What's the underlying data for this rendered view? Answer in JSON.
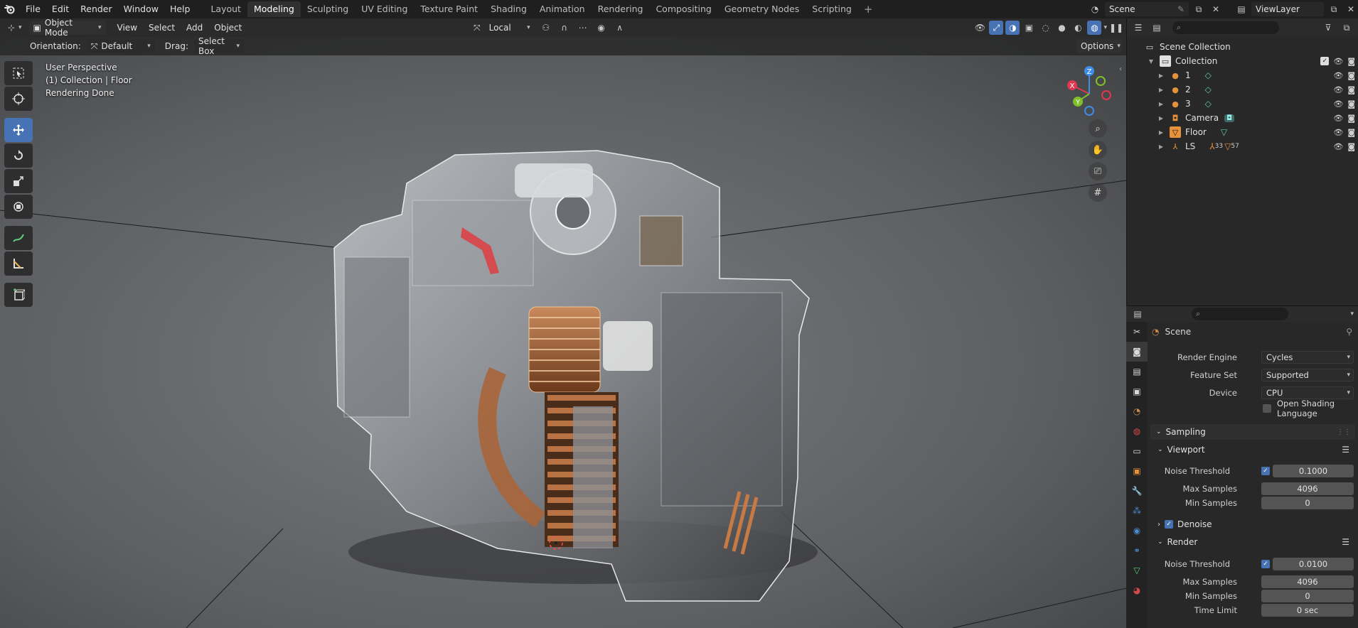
{
  "menu": [
    "File",
    "Edit",
    "Render",
    "Window",
    "Help"
  ],
  "workspaces": [
    {
      "label": "Layout"
    },
    {
      "label": "Modeling",
      "active": true
    },
    {
      "label": "Sculpting"
    },
    {
      "label": "UV Editing"
    },
    {
      "label": "Texture Paint"
    },
    {
      "label": "Shading"
    },
    {
      "label": "Animation"
    },
    {
      "label": "Rendering"
    },
    {
      "label": "Compositing"
    },
    {
      "label": "Geometry Nodes"
    },
    {
      "label": "Scripting"
    }
  ],
  "top_right": {
    "scene": "Scene",
    "view_layer": "ViewLayer"
  },
  "viewport_header": {
    "mode": "Object Mode",
    "menus": [
      "View",
      "Select",
      "Add",
      "Object"
    ],
    "transform_orientation": "Local",
    "orientation_label": "Orientation:",
    "orientation_value": "Default",
    "drag_label": "Drag:",
    "drag_value": "Select Box",
    "options": "Options"
  },
  "viewport_info": {
    "line1": "User Perspective",
    "line2": "(1) Collection | Floor",
    "line3": "Rendering Done"
  },
  "gizmo": {
    "x": "X",
    "y": "Y",
    "z": "Z"
  },
  "outliner": {
    "root": "Scene Collection",
    "collection": "Collection",
    "items": [
      {
        "name": "1",
        "icon": "light-icon"
      },
      {
        "name": "2",
        "icon": "light-icon"
      },
      {
        "name": "3",
        "icon": "light-icon"
      },
      {
        "name": "Camera",
        "icon": "camera-icon"
      },
      {
        "name": "Floor",
        "icon": "mesh-icon"
      },
      {
        "name": "LS",
        "icon": "armature-icon",
        "sub_a": "33",
        "sub_b": "57"
      }
    ]
  },
  "properties": {
    "context": "Scene",
    "render_engine_label": "Render Engine",
    "render_engine": "Cycles",
    "feature_set_label": "Feature Set",
    "feature_set": "Supported",
    "device_label": "Device",
    "device": "CPU",
    "osl_label": "Open Shading Language",
    "sampling": "Sampling",
    "viewport": "Viewport",
    "vp_noise_label": "Noise Threshold",
    "vp_noise": "0.1000",
    "vp_max_label": "Max Samples",
    "vp_max": "4096",
    "vp_min_label": "Min Samples",
    "vp_min": "0",
    "denoise": "Denoise",
    "render": "Render",
    "r_noise_label": "Noise Threshold",
    "r_noise": "0.0100",
    "r_max_label": "Max Samples",
    "r_max": "4096",
    "r_min_label": "Min Samples",
    "r_min": "0",
    "time_limit_label": "Time Limit",
    "time_limit": "0 sec"
  },
  "colors": {
    "accent": "#4772b3",
    "axis_x": "#e0394f",
    "axis_y": "#7fbf2a",
    "axis_z": "#3d8ce6"
  }
}
